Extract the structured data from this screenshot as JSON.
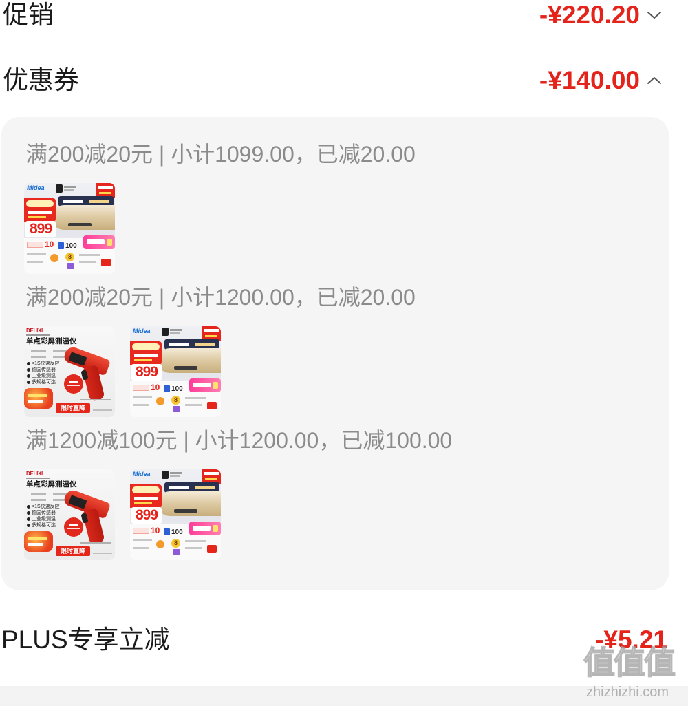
{
  "summary": {
    "promotion": {
      "label": "促销",
      "amount": "-¥220.20",
      "chevron": "chevron-down-icon"
    },
    "coupon": {
      "label": "优惠券",
      "amount": "-¥140.00",
      "chevron": "chevron-up-icon"
    },
    "plus": {
      "label": "PLUS专享立减",
      "amount": "-¥5.21"
    }
  },
  "coupon_details": [
    {
      "text": "满200减20元 | 小计1099.00，已减20.00",
      "items": [
        "midea-water-heater-image"
      ]
    },
    {
      "text": "满200减20元 | 小计1200.00，已减20.00",
      "items": [
        "delixi-thermometer-image",
        "midea-water-heater-image"
      ]
    },
    {
      "text": "满1200减100元 | 小计1200.00，已减100.00",
      "items": [
        "delixi-thermometer-image",
        "midea-water-heater-image"
      ]
    }
  ],
  "products": {
    "midea": {
      "brand": "Midea",
      "price": "899",
      "benefit_values": [
        "10",
        "100",
        "8"
      ]
    },
    "delixi": {
      "brand": "DELIXI",
      "title": "单点彩屏测温仪",
      "features": [
        "<1S快速反应",
        "德国传感器",
        "工业级测温",
        "多规格可选"
      ],
      "cta": "限时直降"
    }
  },
  "watermark": {
    "glyphs": "值值值",
    "domain": "zhizhizhi.com"
  },
  "colors": {
    "discount_red": "#e4231b",
    "label_text": "#1a1a1a",
    "muted_text": "#8b8b8b",
    "panel_bg": "#f5f5f5"
  }
}
